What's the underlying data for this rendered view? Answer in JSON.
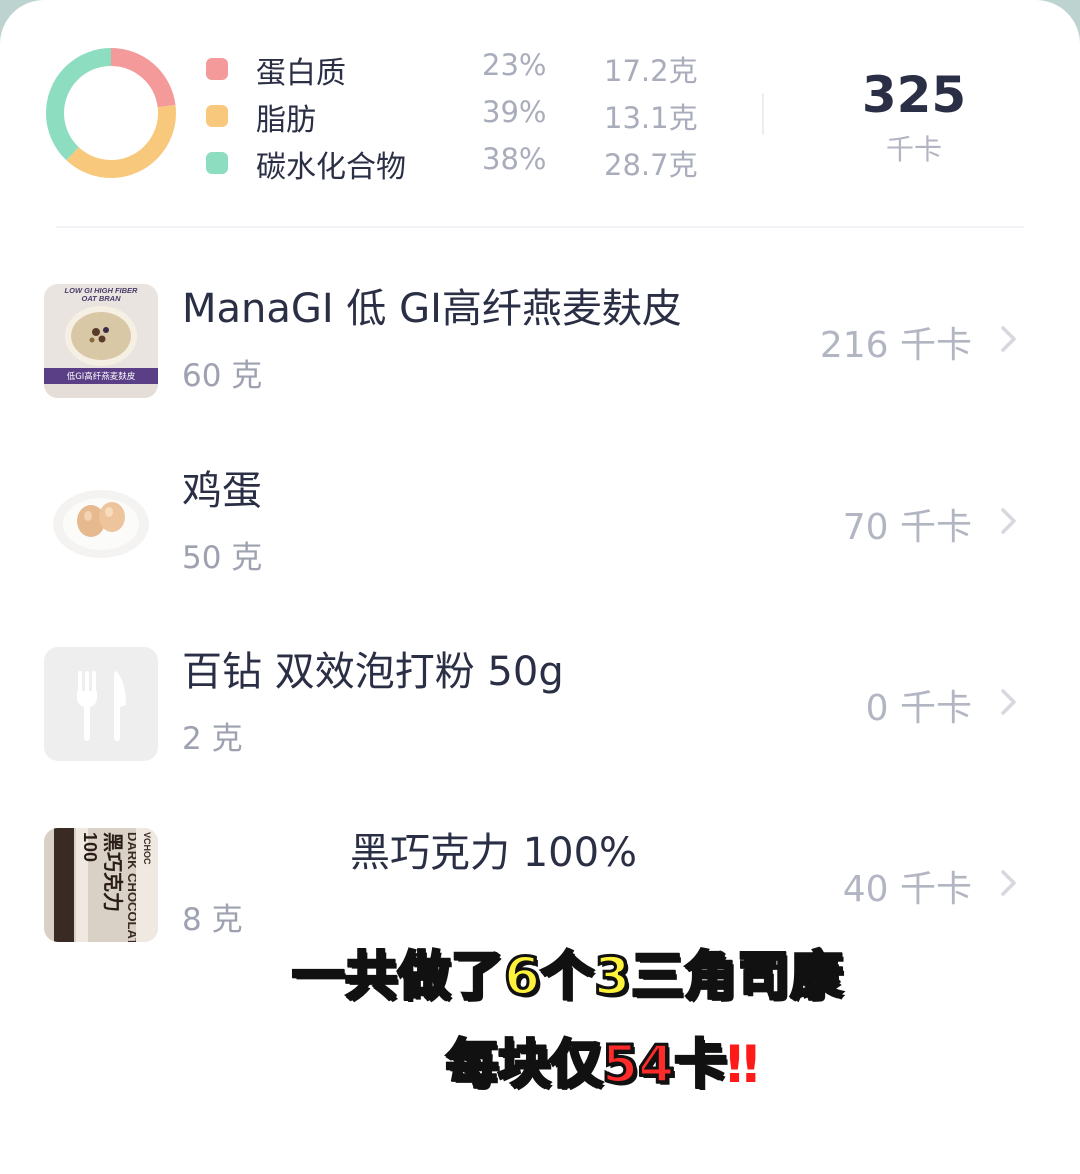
{
  "summary": {
    "macros": [
      {
        "name": "蛋白质",
        "percent": "23%",
        "grams": "17.2克",
        "color": "#f49a9a",
        "share": 0.23
      },
      {
        "name": "脂肪",
        "percent": "39%",
        "grams": "13.1克",
        "color": "#f8c97c",
        "share": 0.39
      },
      {
        "name": "碳水化合物",
        "percent": "38%",
        "grams": "28.7克",
        "color": "#8dddc0",
        "share": 0.38
      }
    ],
    "total_kcal": "325",
    "kcal_unit": "千卡"
  },
  "foods": [
    {
      "name": "ManaGI 低 GI高纤燕麦麸皮",
      "weight": "60 克",
      "kcal": "216 千卡",
      "thumb_texts": [
        "LOW GI HIGH FIBER",
        "OAT BRAN",
        "低GI高纤燕麦麸皮"
      ],
      "thumb_icon": "oat-bran-package-image"
    },
    {
      "name": "鸡蛋",
      "weight": "50 克",
      "kcal": "70 千卡",
      "thumb_icon": "eggs-on-plate-image"
    },
    {
      "name": "百钻 双效泡打粉 50g",
      "weight": "2 克",
      "kcal": "0 千卡",
      "thumb_icon": "fork-knife-icon"
    },
    {
      "name": "黑巧克力 100%",
      "weight": "8 克",
      "kcal": "40 千卡",
      "thumb_texts": [
        "黑巧克力",
        "100",
        "DARK CHOCOLATE",
        "VCHOC"
      ],
      "thumb_icon": "dark-chocolate-package-image"
    }
  ],
  "overlay": {
    "caption_line1": "一共做了6个3三角司康",
    "caption_line2": "每块仅54卡",
    "caption_mark": "‼"
  }
}
